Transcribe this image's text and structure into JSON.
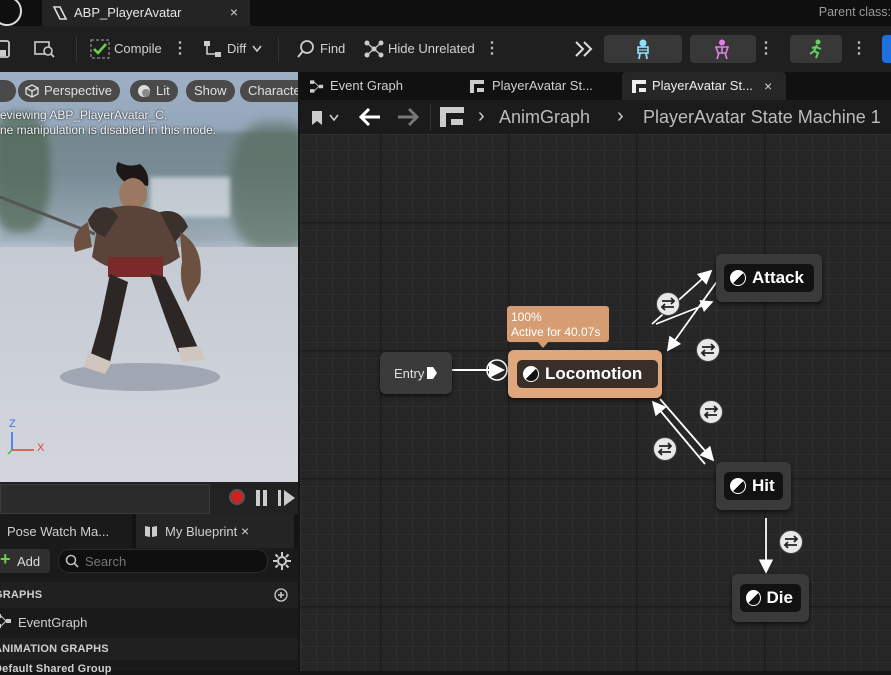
{
  "window": {
    "tab_title": "ABP_PlayerAvatar",
    "tab_close": "×",
    "parent_class": "Parent class:"
  },
  "toolbar": {
    "compile": "Compile",
    "diff": "Diff",
    "find": "Find",
    "hide_unrelated": "Hide Unrelated"
  },
  "viewport": {
    "perspective": "Perspective",
    "lit": "Lit",
    "show": "Show",
    "character": "Characte",
    "msg1": "eviewing ABP_PlayerAvatar_C.",
    "msg2": "ne manipulation is disabled in this mode.",
    "axis_z": "Z",
    "axis_x": "X"
  },
  "left_panel": {
    "tab1": "Pose Watch Ma...",
    "tab2": "My Blueprint",
    "tab2_close": "×",
    "add": "Add",
    "search_placeholder": "Search",
    "graphs_header": "GRAPHS",
    "event_graph": "EventGraph",
    "anim_graphs_header": "ANIMATION GRAPHS",
    "default_group": "Default Shared Group"
  },
  "graph_tabs": [
    {
      "label": "Event Graph"
    },
    {
      "label": "PlayerAvatar St..."
    },
    {
      "label": "PlayerAvatar St...",
      "close": "×"
    }
  ],
  "breadcrumb": {
    "seg1": "AnimGraph",
    "seg2": "PlayerAvatar State Machine 1"
  },
  "graph": {
    "entry": "Entry",
    "locomotion": "Locomotion",
    "attack": "Attack",
    "hit": "Hit",
    "die": "Die",
    "tooltip_line1": "100%",
    "tooltip_line2": "Active for 40.07s"
  },
  "colors": {
    "active_state": "#e0a67c",
    "accent_blue": "#1e6fe0",
    "compile_green": "#6bd04a"
  }
}
